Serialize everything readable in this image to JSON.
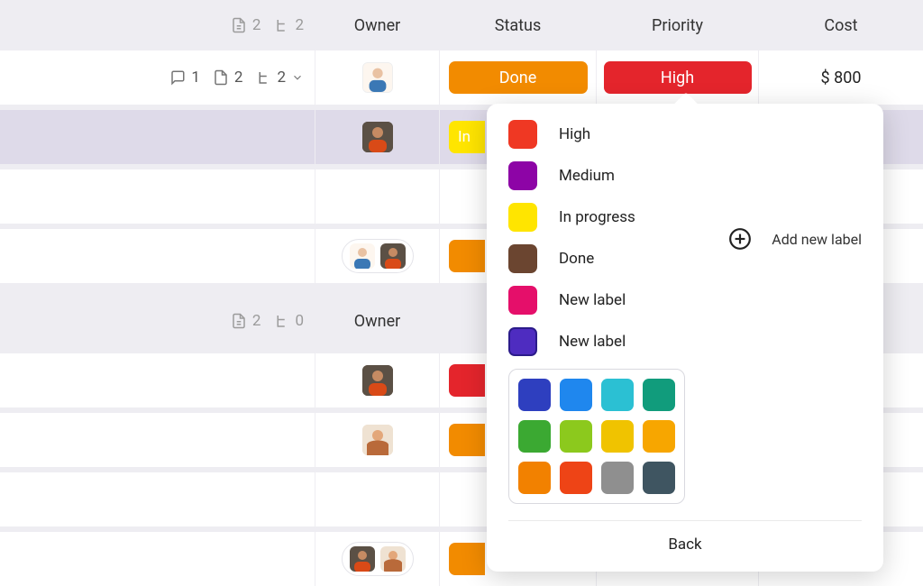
{
  "headers": {
    "owner": "Owner",
    "status": "Status",
    "priority": "Priority",
    "cost": "Cost",
    "group1_files": "2",
    "group1_subs": "2",
    "group2_files": "2",
    "group2_subs": "0"
  },
  "row1": {
    "comments": "1",
    "files": "2",
    "subs": "2",
    "status_label": "Done",
    "priority_label": "High",
    "cost": "$ 800"
  },
  "row2": {
    "status_label_partial": "In"
  },
  "popover": {
    "labels": [
      {
        "text": "High",
        "color": "#ef3823"
      },
      {
        "text": "Medium",
        "color": "#8d04a6"
      },
      {
        "text": "In progress",
        "color": "#ffe500"
      },
      {
        "text": "Done",
        "color": "#6b4530"
      },
      {
        "text": "New label",
        "color": "#e50f6a"
      },
      {
        "text": "New label",
        "color": "#4e2cc0"
      }
    ],
    "add_new": "Add new label",
    "palette": [
      "#2e3fbf",
      "#1f87ee",
      "#2bc0d3",
      "#119c7c",
      "#3ba932",
      "#8cc91d",
      "#f0c300",
      "#f7a600",
      "#f28100",
      "#ee4416",
      "#8f8f8f",
      "#3f5561"
    ],
    "back": "Back"
  }
}
